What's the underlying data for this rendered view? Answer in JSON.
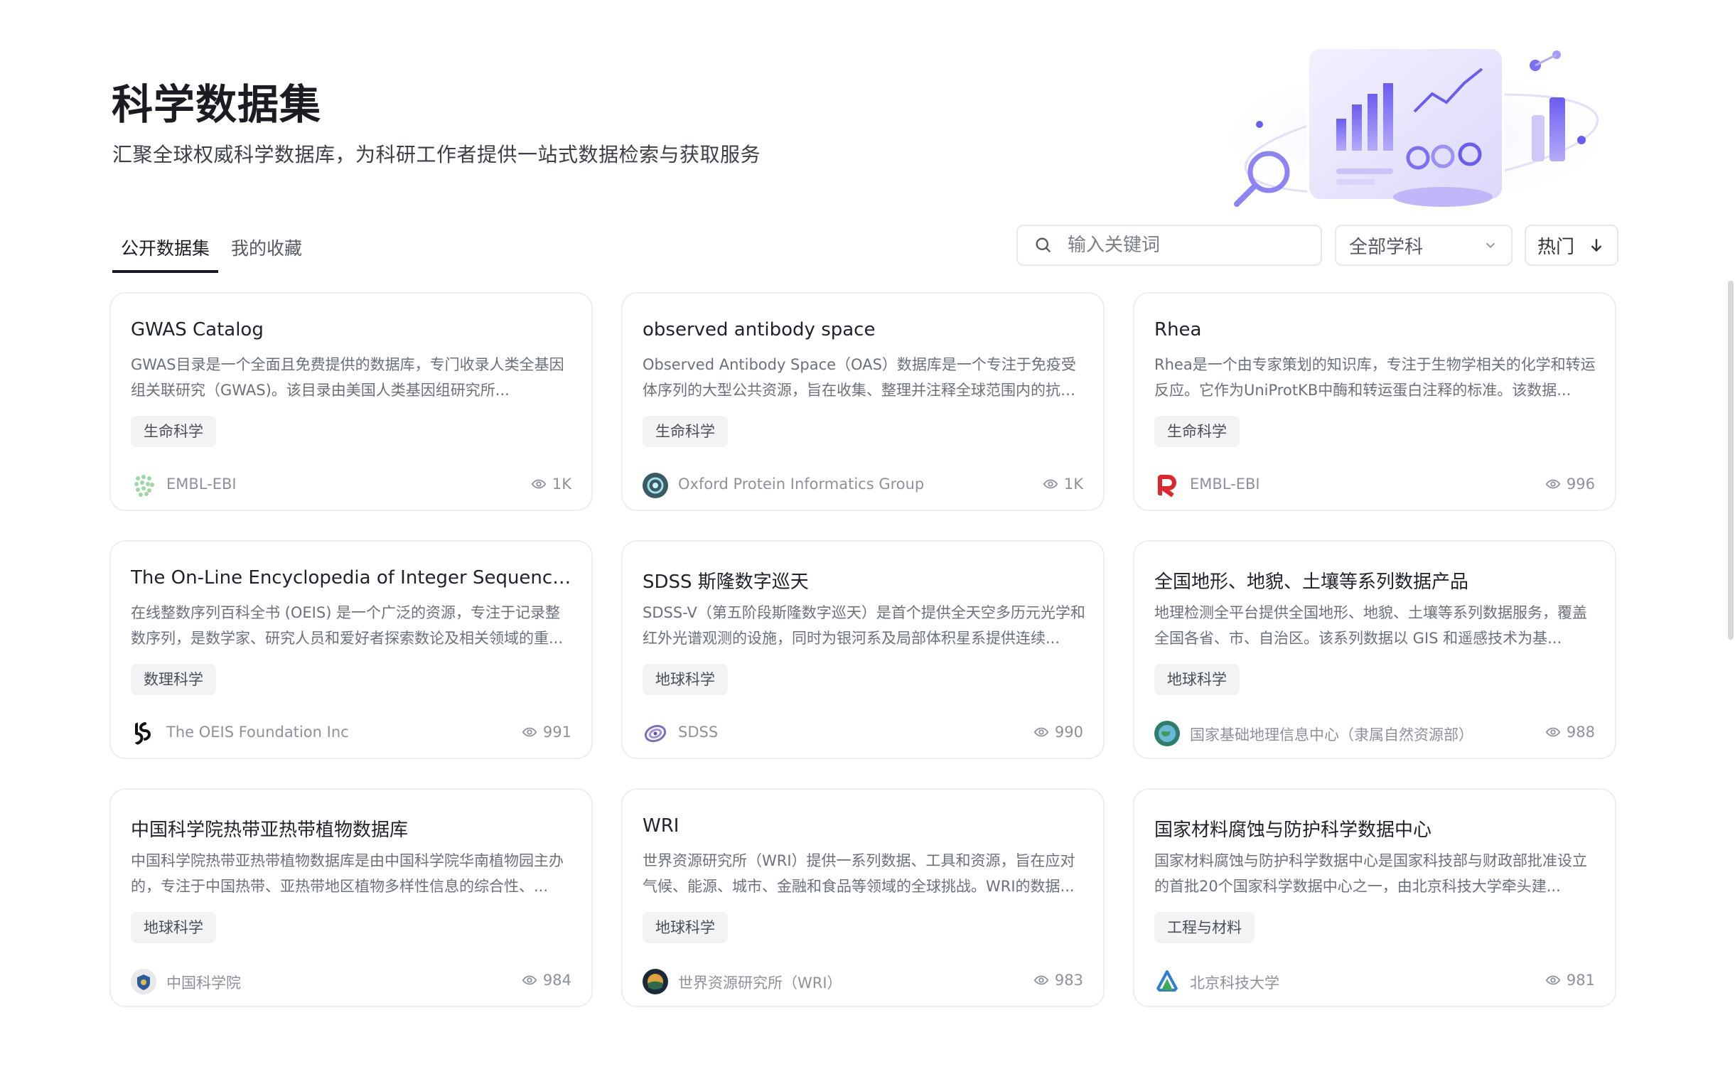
{
  "hero": {
    "title": "科学数据集",
    "subtitle": "汇聚全球权威科学数据库，为科研工作者提供一站式数据检索与获取服务"
  },
  "tabs": [
    {
      "label": "公开数据集",
      "active": true
    },
    {
      "label": "我的收藏",
      "active": false
    }
  ],
  "search": {
    "placeholder": "输入关键词",
    "value": ""
  },
  "subject_filter": {
    "selected": "全部学科"
  },
  "sort": {
    "label": "热门"
  },
  "cards": [
    {
      "title": "GWAS Catalog",
      "description": "GWAS目录是一个全面且免费提供的数据库，专门收录人类全基因组关联研究（GWAS)。该目录由美国人类基因组研究所...",
      "tag": "生命科学",
      "org": "EMBL-EBI",
      "views": "1K",
      "logo": "embl-dots-logo"
    },
    {
      "title": "observed antibody space",
      "description": "Observed Antibody Space（OAS）数据库是一个专注于免疫受体序列的大型公共资源，旨在收集、整理并注释全球范围内的抗体...",
      "tag": "生命科学",
      "org": "Oxford Protein Informatics Group",
      "views": "1K",
      "logo": "opig-logo"
    },
    {
      "title": "Rhea",
      "description": "Rhea是一个由专家策划的知识库，专注于生物学相关的化学和转运反应。它作为UniProtKB中酶和转运蛋白注释的标准。该数据...",
      "tag": "生命科学",
      "org": "EMBL-EBI",
      "views": "996",
      "logo": "rhea-logo"
    },
    {
      "title": "The On-Line Encyclopedia of Integer Sequences...",
      "description": "在线整数序列百科全书 (OEIS) 是一个广泛的资源，专注于记录整数序列，是数学家、研究人员和爱好者探索数论及相关领域的重...",
      "tag": "数理科学",
      "org": "The OEIS Foundation Inc",
      "views": "991",
      "logo": "oeis-logo"
    },
    {
      "title": "SDSS 斯隆数字巡天",
      "description": "SDSS-V（第五阶段斯隆数字巡天）是首个提供全天空多历元光学和红外光谱观测的设施，同时为银河系及局部体积星系提供连续...",
      "tag": "地球科学",
      "org": "SDSS",
      "views": "990",
      "logo": "sdss-logo"
    },
    {
      "title": "全国地形、地貌、土壤等系列数据产品",
      "description": "地理检测全平台提供全国地形、地貌、土壤等系列数据服务，覆盖全国各省、市、自治区。该系列数据以 GIS 和遥感技术为基...",
      "tag": "地球科学",
      "org": "国家基础地理信息中心（隶属自然资源部）",
      "views": "988",
      "logo": "ngcc-logo"
    },
    {
      "title": "中国科学院热带亚热带植物数据库",
      "description": "中国科学院热带亚热带植物数据库是由中国科学院华南植物园主办的，专注于中国热带、亚热带地区植物多样性信息的综合性、...",
      "tag": "地球科学",
      "org": "中国科学院",
      "views": "984",
      "logo": "cas-logo"
    },
    {
      "title": "WRI",
      "description": "世界资源研究所（WRI）提供一系列数据、工具和资源，旨在应对气候、能源、城市、金融和食品等领域的全球挑战。WRI的数据...",
      "tag": "地球科学",
      "org": "世界资源研究所（WRI）",
      "views": "983",
      "logo": "wri-logo"
    },
    {
      "title": "国家材料腐蚀与防护科学数据中心",
      "description": "国家材料腐蚀与防护科学数据中心是国家科技部与财政部批准设立的首批20个国家科学数据中心之一，由北京科技大学牵头建...",
      "tag": "工程与材料",
      "org": "北京科技大学",
      "views": "981",
      "logo": "ustb-logo"
    }
  ]
}
